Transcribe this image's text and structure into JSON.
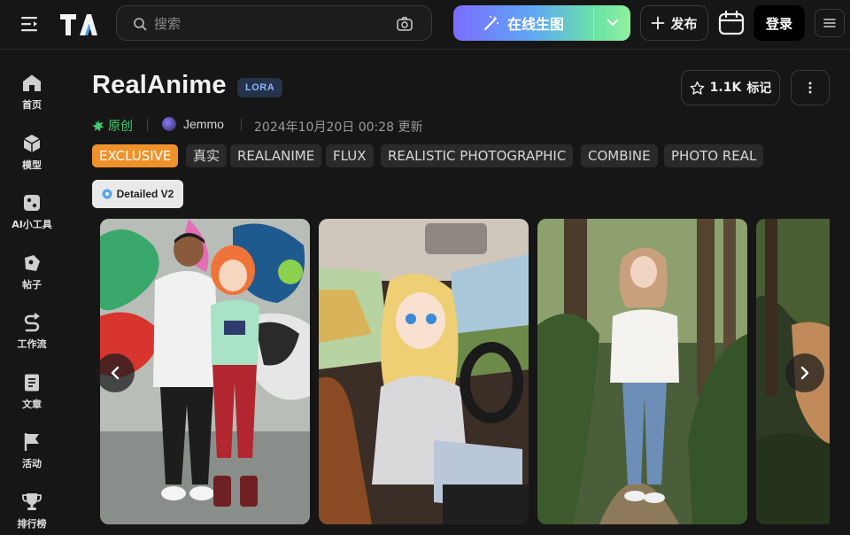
{
  "header": {
    "search": {
      "placeholder": "搜索"
    },
    "generate_label": "在线生图",
    "publish_label": "发布",
    "login_label": "登录"
  },
  "sidebar": {
    "items": [
      {
        "label": "首页",
        "icon": "home-icon"
      },
      {
        "label": "模型",
        "icon": "cube-icon"
      },
      {
        "label": "AI小工具",
        "icon": "tools-icon"
      },
      {
        "label": "帖子",
        "icon": "post-icon"
      },
      {
        "label": "工作流",
        "icon": "workflow-icon"
      },
      {
        "label": "文章",
        "icon": "article-icon"
      },
      {
        "label": "活动",
        "icon": "flag-icon"
      },
      {
        "label": "排行榜",
        "icon": "trophy-icon"
      }
    ]
  },
  "model": {
    "title": "RealAnime",
    "type_badge": "LORA",
    "original_label": "原创",
    "author": "Jemmo",
    "updated": "2024年10月20日 00:28 更新",
    "favorite_count": "1.1K",
    "favorite_label": "标记",
    "tags": [
      "EXCLUSIVE",
      "真实",
      "REALANIME",
      "FLUX",
      "REALISTIC PHOTOGRAPHIC",
      "COMBINE",
      "PHOTO REAL"
    ],
    "version": "Detailed V2"
  },
  "colors": {
    "background": "#161616",
    "exclusive_tag": "#f0922b",
    "original_green": "#3fce72",
    "lora_badge_bg": "#24324a",
    "lora_badge_text": "#8fb4ff"
  }
}
